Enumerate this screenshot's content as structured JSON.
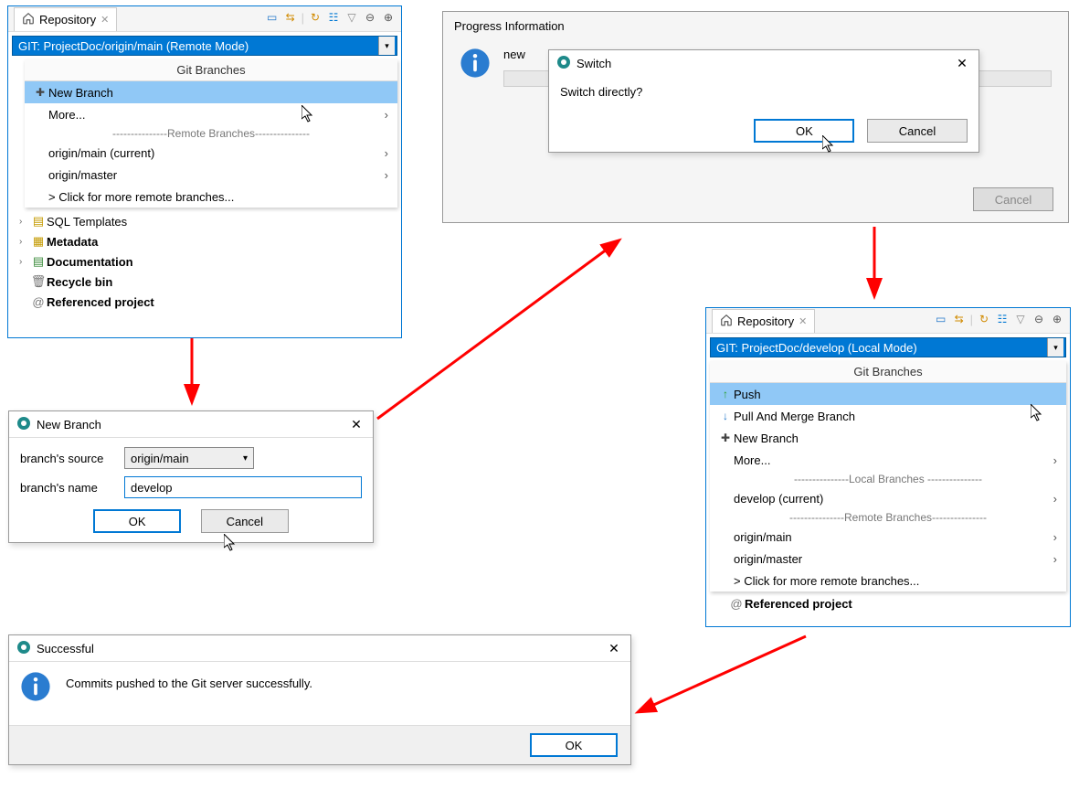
{
  "repo1": {
    "tab_label": "Repository",
    "git_select": "GIT: ProjectDoc/origin/main   (Remote Mode)",
    "branches_header": "Git Branches",
    "new_branch": "New Branch",
    "more": "More...",
    "remote_sep": "---------------Remote Branches---------------",
    "origin_main": "origin/main (current)",
    "origin_master": "origin/master",
    "more_remote": "> Click for more remote branches...",
    "tree": {
      "sql_templates": "SQL Templates",
      "metadata": "Metadata",
      "documentation": "Documentation",
      "recycle": "Recycle bin",
      "referenced": "Referenced project"
    }
  },
  "progress": {
    "title": "Progress Information",
    "partial_text": "new",
    "cancel": "Cancel"
  },
  "switch_dlg": {
    "title": "Switch",
    "question": "Switch directly?",
    "ok": "OK",
    "cancel": "Cancel"
  },
  "newbranch": {
    "title": "New Branch",
    "source_label": "branch's source",
    "source_value": "origin/main",
    "name_label": "branch's name",
    "name_value": "develop",
    "ok": "OK",
    "cancel": "Cancel"
  },
  "repo2": {
    "tab_label": "Repository",
    "git_select": "GIT: ProjectDoc/develop   (Local Mode)",
    "branches_header": "Git Branches",
    "push": "Push",
    "pull": "Pull And Merge Branch",
    "new_branch": "New Branch",
    "more": "More...",
    "local_sep": "---------------Local   Branches  ---------------",
    "develop": "develop (current)",
    "remote_sep": "---------------Remote Branches---------------",
    "origin_main": "origin/main",
    "origin_master": "origin/master",
    "more_remote": "> Click for more remote branches...",
    "referenced": "Referenced project"
  },
  "success": {
    "title": "Successful",
    "msg": "Commits pushed to the Git server successfully.",
    "ok": "OK"
  }
}
